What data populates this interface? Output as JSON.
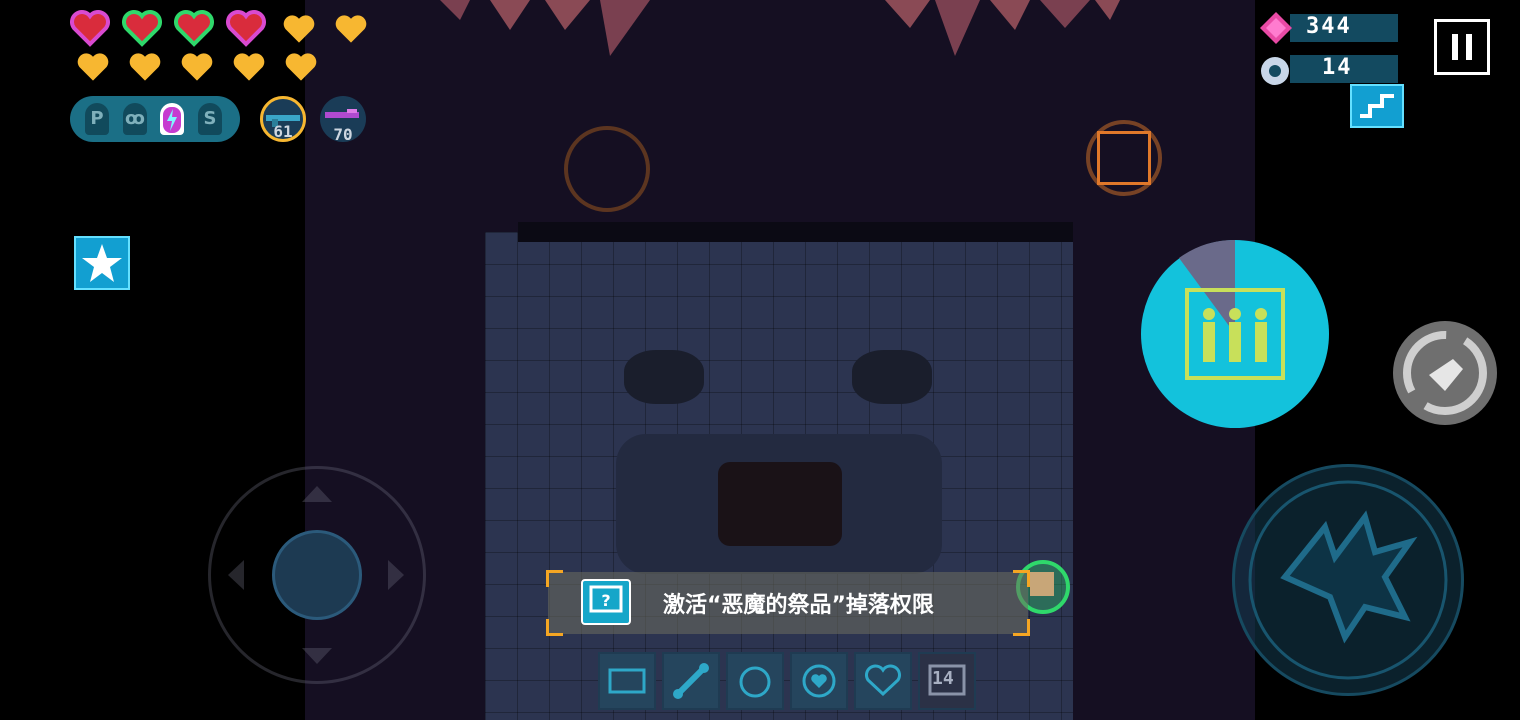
{
  "hud": {
    "armor_hearts": [
      "pink-green-heart",
      "green-heart",
      "green-heart",
      "pink-heart"
    ],
    "gold_hearts_row1": 2,
    "gold_hearts_row2": 5,
    "buffs": [
      {
        "label": "P"
      },
      {
        "label": "ꝏ"
      },
      {
        "label": ""
      },
      {
        "label": "S"
      }
    ],
    "weapons": [
      {
        "count": "61",
        "selected": true
      },
      {
        "count": "70",
        "selected": false
      }
    ]
  },
  "currency": {
    "gems": "344",
    "parts": "14"
  },
  "notification": {
    "text": "激活“恶魔的祭品”掉落权限"
  },
  "items": {
    "stack_count": "14"
  },
  "colors": {
    "accent": "#13c2dc",
    "notify_corner": "#f5a623",
    "gem": "#e94aa5",
    "gold_heart": "#f7b731",
    "red_heart": "#d92c3c"
  }
}
